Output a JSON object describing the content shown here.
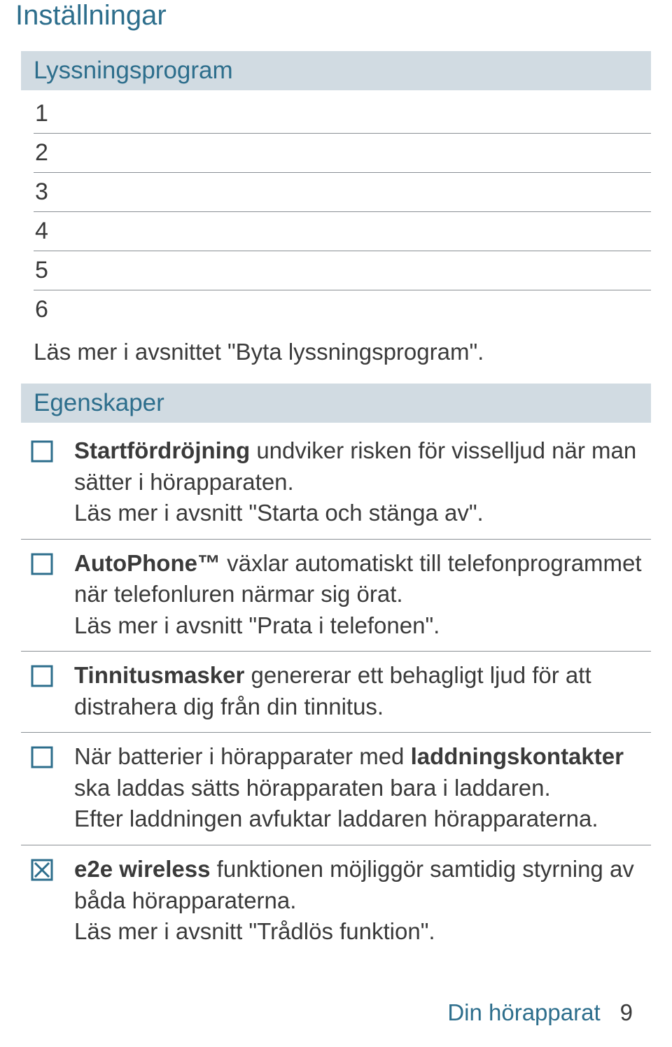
{
  "title": "Inställningar",
  "sections": {
    "programs_header": "Lyssningsprogram",
    "programs": [
      "1",
      "2",
      "3",
      "4",
      "5",
      "6"
    ],
    "programs_note": "Läs mer i avsnittet \"Byta lyssningsprogram\".",
    "features_header": "Egenskaper"
  },
  "features": [
    {
      "checked": false,
      "parts": [
        {
          "b": true,
          "t": "Startfördröjning"
        },
        {
          "b": false,
          "t": " undviker risken för visselljud när man sätter i hörapparaten."
        },
        {
          "br": true
        },
        {
          "b": false,
          "t": "Läs mer i avsnitt \"Starta och stänga av\"."
        }
      ]
    },
    {
      "checked": false,
      "parts": [
        {
          "b": true,
          "t": "AutoPhone™"
        },
        {
          "b": false,
          "t": " växlar automatiskt till telefonprogrammet när telefonluren närmar sig örat."
        },
        {
          "br": true
        },
        {
          "b": false,
          "t": "Läs mer i avsnitt \"Prata i telefonen\"."
        }
      ]
    },
    {
      "checked": false,
      "parts": [
        {
          "b": true,
          "t": "Tinnitusmasker"
        },
        {
          "b": false,
          "t": " genererar ett behagligt ljud för att distrahera dig från din tinnitus."
        }
      ]
    },
    {
      "checked": false,
      "parts": [
        {
          "b": false,
          "t": "När batterier i hörapparater med "
        },
        {
          "b": true,
          "t": "laddningskontakter"
        },
        {
          "b": false,
          "t": " ska laddas sätts hörapparaten bara i laddaren."
        },
        {
          "br": true
        },
        {
          "b": false,
          "t": "Efter laddningen avfuktar laddaren hörapparaterna."
        }
      ]
    },
    {
      "checked": true,
      "parts": [
        {
          "b": true,
          "t": "e2e wireless"
        },
        {
          "b": false,
          "t": " funktionen möjliggör samtidig styrning av båda hörapparaterna."
        },
        {
          "br": true
        },
        {
          "b": false,
          "t": "Läs mer i avsnitt \"Trådlös funktion\"."
        }
      ]
    }
  ],
  "footer": {
    "label": "Din hörapparat",
    "page": "9"
  }
}
